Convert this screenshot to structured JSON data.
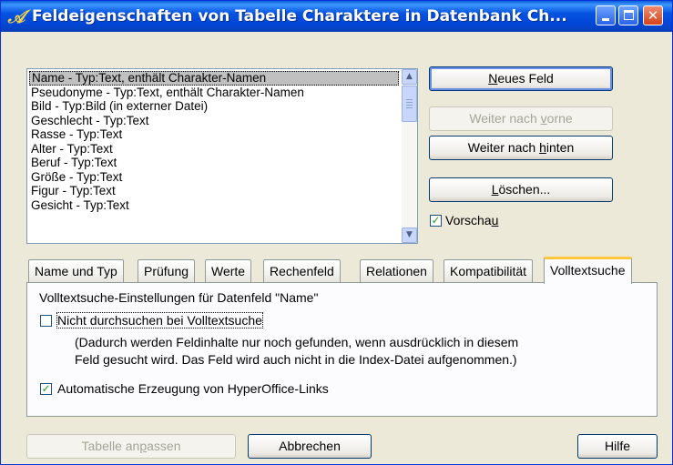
{
  "window": {
    "title": "Feldeigenschaften von Tabelle Charaktere in Datenbank Ch...",
    "icon": "hyperoffice-icon",
    "minimize_icon": "minimize-icon",
    "maximize_icon": "maximize-icon",
    "close_icon": "close-icon"
  },
  "fields": {
    "items": [
      "Name - Typ:Text, enthält Charakter-Namen",
      "Pseudonyme - Typ:Text, enthält Charakter-Namen",
      "Bild - Typ:Bild (in externer Datei)",
      "Geschlecht - Typ:Text",
      "Rasse - Typ:Text",
      "Alter - Typ:Text",
      "Beruf - Typ:Text",
      "Größe - Typ:Text",
      "Figur - Typ:Text",
      "Gesicht - Typ:Text"
    ],
    "selected_index": 0
  },
  "buttons": {
    "new_field_pre": "",
    "new_field_key": "N",
    "new_field_post": "eues Feld",
    "move_up_pre": "Weiter nach ",
    "move_up_key": "v",
    "move_up_post": "orne",
    "move_down_pre": "Weiter nach ",
    "move_down_key": "h",
    "move_down_post": "inten",
    "delete_pre": "",
    "delete_key": "L",
    "delete_post": "öschen...",
    "adjust_table_pre": "Tabelle an",
    "adjust_table_key": "p",
    "adjust_table_post": "assen",
    "cancel": "Abbrechen",
    "help": "Hilfe"
  },
  "preview": {
    "label_pre": "Vorscha",
    "label_key": "u",
    "label_post": "",
    "checked": true
  },
  "tabs": [
    "Name und Typ",
    "Prüfung",
    "Werte",
    "Rechenfeld",
    "Relationen",
    "Kompatibilität",
    "Volltextsuche"
  ],
  "active_tab": "Volltextsuche",
  "fulltext": {
    "heading": "Volltextsuche-Einstellungen für Datenfeld \"Name\"",
    "exclude_label": "Nicht durchsuchen bei Volltextsuche",
    "exclude_checked": false,
    "note_line1": "(Dadurch werden Feldinhalte nur noch gefunden, wenn ausdrücklich in diesem",
    "note_line2": "Feld gesucht wird. Das Feld wird auch nicht in die Index-Datei aufgenommen.)",
    "auto_links_label": "Automatische Erzeugung von HyperOffice-Links",
    "auto_links_checked": true
  },
  "colors": {
    "titlebar": "#0553e0",
    "dialog_bg": "#ece9d8",
    "active_tab_highlight": "#ffc83c",
    "checkmark": "#21a121"
  }
}
